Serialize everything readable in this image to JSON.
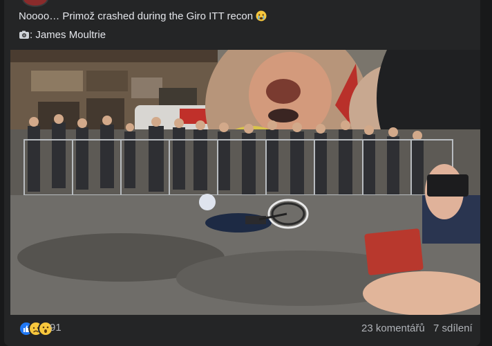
{
  "post": {
    "text": "Noooo… Primož crashed during the Giro ITT recon",
    "credit_text": "James Moultrie",
    "text_emoji": "crying-face-icon",
    "credit_emoji": "camera-icon"
  },
  "photo": {
    "description_icon": "photo-image"
  },
  "engagement": {
    "reaction_icons": [
      "like-icon",
      "sad-icon",
      "wow-icon"
    ],
    "reaction_count": "91",
    "comments": "23 komentářů",
    "shares": "7 sdílení"
  },
  "colors": {
    "background": "#18191a",
    "card": "#242526",
    "text_primary": "#e4e6eb",
    "text_secondary": "#b0b3b8",
    "like_blue": "#2078f4",
    "emoji_yellow": "#f7c73d"
  }
}
